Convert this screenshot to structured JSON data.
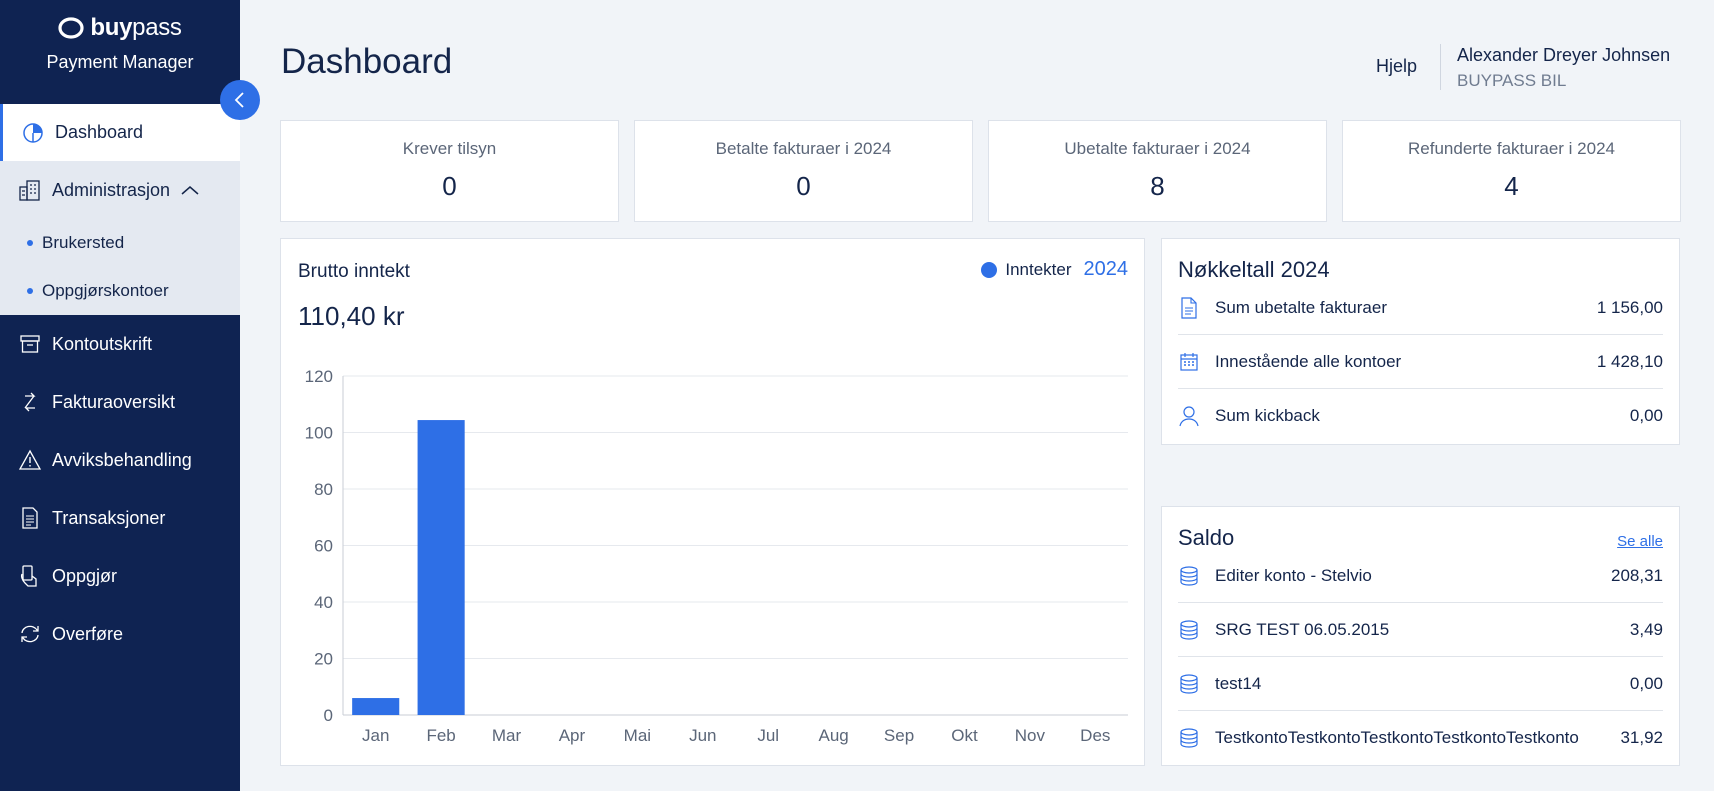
{
  "brand": {
    "logo_bold": "buy",
    "logo_thin": "pass",
    "app_name": "Payment Manager"
  },
  "nav": {
    "dashboard": "Dashboard",
    "administrasjon": "Administrasjon",
    "brukersted": "Brukersted",
    "oppgjorskontoer": "Oppgjørskontoer",
    "kontoutskrift": "Kontoutskrift",
    "fakturaoversikt": "Fakturaoversikt",
    "avviksbehandling": "Avviksbehandling",
    "transaksjoner": "Transaksjoner",
    "oppgjor": "Oppgjør",
    "overfore": "Overføre"
  },
  "header": {
    "title": "Dashboard",
    "help": "Hjelp",
    "user_name": "Alexander Dreyer Johnsen",
    "user_org": "BUYPASS BIL"
  },
  "stats": [
    {
      "label": "Krever tilsyn",
      "value": "0"
    },
    {
      "label": "Betalte fakturaer i 2024",
      "value": "0"
    },
    {
      "label": "Ubetalte fakturaer i 2024",
      "value": "8"
    },
    {
      "label": "Refunderte fakturaer i 2024",
      "value": "4"
    }
  ],
  "revenue": {
    "title": "Brutto inntekt",
    "total": "110,40 kr",
    "legend": "Inntekter",
    "year": "2024"
  },
  "chart_data": {
    "type": "bar",
    "categories": [
      "Jan",
      "Feb",
      "Mar",
      "Apr",
      "Mai",
      "Jun",
      "Jul",
      "Aug",
      "Sep",
      "Okt",
      "Nov",
      "Des"
    ],
    "series": [
      {
        "name": "Inntekter",
        "values": [
          6,
          104.4,
          0,
          0,
          0,
          0,
          0,
          0,
          0,
          0,
          0,
          0
        ]
      }
    ],
    "yticks": [
      0,
      20,
      40,
      60,
      80,
      100,
      120
    ],
    "ylim": [
      0,
      120
    ],
    "grid": true,
    "color": "#2e6fe6",
    "legend_position": "top-right"
  },
  "nokkeltall": {
    "title": "Nøkkeltall 2024",
    "rows": [
      {
        "icon": "document-icon",
        "label": "Sum ubetalte fakturaer",
        "value": "1 156,00"
      },
      {
        "icon": "calendar-icon",
        "label": "Innestående alle kontoer",
        "value": "1 428,10"
      },
      {
        "icon": "user-icon",
        "label": "Sum kickback",
        "value": "0,00"
      }
    ]
  },
  "saldo": {
    "title": "Saldo",
    "see_all": "Se alle",
    "rows": [
      {
        "icon": "coins-icon",
        "label": "Editer konto - Stelvio",
        "value": "208,31"
      },
      {
        "icon": "coins-icon",
        "label": "SRG TEST 06.05.2015",
        "value": "3,49"
      },
      {
        "icon": "coins-icon",
        "label": "test14",
        "value": "0,00"
      },
      {
        "icon": "coins-icon",
        "label": "TestkontoTestkontoTestkontoTestkontoTestkonto",
        "value": "31,92"
      }
    ]
  }
}
